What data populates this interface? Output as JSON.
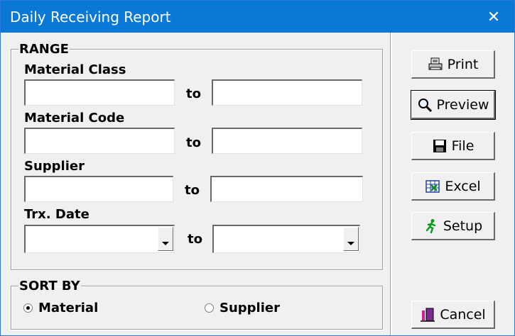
{
  "window": {
    "title": "Daily Receiving Report",
    "close_glyph": "✕"
  },
  "range": {
    "legend": "RANGE",
    "material_class": {
      "label": "Material Class",
      "to": "to",
      "from_value": "",
      "to_value": ""
    },
    "material_code": {
      "label": "Material Code",
      "to": "to",
      "from_value": "",
      "to_value": ""
    },
    "supplier": {
      "label": "Supplier",
      "to": "to",
      "from_value": "",
      "to_value": ""
    },
    "trx_date": {
      "label": "Trx. Date",
      "to": "to",
      "from_value": "",
      "to_value": ""
    }
  },
  "sort": {
    "legend": "SORT BY",
    "options": [
      {
        "label": "Material",
        "checked": true
      },
      {
        "label": "Supplier",
        "checked": false
      }
    ]
  },
  "buttons": {
    "print": "Print",
    "preview": "Preview",
    "file": "File",
    "excel": "Excel",
    "setup": "Setup",
    "cancel": "Cancel"
  },
  "icons": {
    "print": "printer-icon",
    "preview": "magnifier-icon",
    "file": "floppy-disk-icon",
    "excel": "excel-icon",
    "setup": "running-man-icon",
    "cancel": "exit-door-icon",
    "close": "close-icon"
  }
}
